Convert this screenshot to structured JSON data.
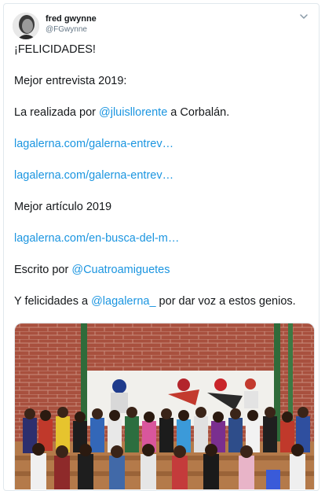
{
  "user": {
    "display_name": "fred gwynne",
    "handle": "@FGwynne",
    "avatar_icon": "user-avatar-photo"
  },
  "menu": {
    "icon": "chevron-down-icon"
  },
  "tweet": {
    "line1": "¡FELICIDADES!",
    "line2": "Mejor entrevista 2019:",
    "line3_prefix": "La realizada por ",
    "line3_mention": "@jluisllorente",
    "line3_suffix": " a Corbalán.",
    "link1": "lagalerna.com/galerna-entrev…",
    "link2": "lagalerna.com/galerna-entrev…",
    "line4": "Mejor artículo 2019",
    "link3": "lagalerna.com/en-busca-del-m…",
    "line5_prefix": "Escrito por ",
    "line5_mention": "@Cuatroamiguetes",
    "line6_prefix": "Y felicidades a ",
    "line6_mention": "@lagalerna_",
    "line6_suffix": " por dar voz a estos genios."
  },
  "colors": {
    "link": "#1b95e0",
    "text": "#14171a",
    "secondary": "#657786",
    "border": "#e1e8ed"
  }
}
